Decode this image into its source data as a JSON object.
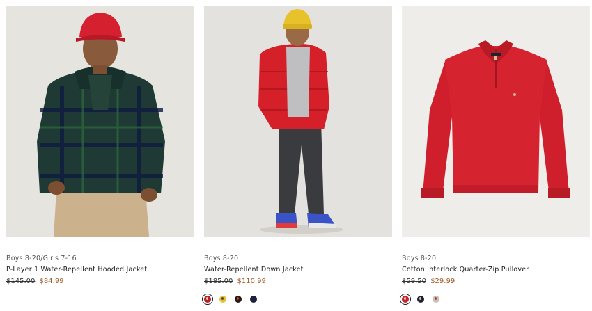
{
  "products": [
    {
      "category": "Boys 8-20/Girls 7-16",
      "name": "P-Layer 1 Water-Repellent Hooded Jacket",
      "original_price": "$145.00",
      "sale_price": "$84.99",
      "swatches": []
    },
    {
      "category": "Boys 8-20",
      "name": "Water-Repellent Down Jacket",
      "original_price": "$185.00",
      "sale_price": "$110.99",
      "swatches": [
        {
          "color": "#b81e2c",
          "selected": true
        },
        {
          "color": "#e2c43a",
          "selected": false
        },
        {
          "color": "#2a1a14",
          "selected": false
        },
        {
          "color": "#1c2238",
          "selected": false
        }
      ]
    },
    {
      "category": "Boys 8-20",
      "name": "Cotton Interlock Quarter-Zip Pullover",
      "original_price": "$59.50",
      "sale_price": "$29.99",
      "swatches": [
        {
          "color": "#c8202e",
          "selected": true
        },
        {
          "color": "#1c2238",
          "selected": false
        },
        {
          "color": "#c9c2b8",
          "selected": false
        }
      ]
    }
  ],
  "colors": {
    "sale": "#a35a2a",
    "text": "#1a1a1a",
    "category": "#555555"
  }
}
